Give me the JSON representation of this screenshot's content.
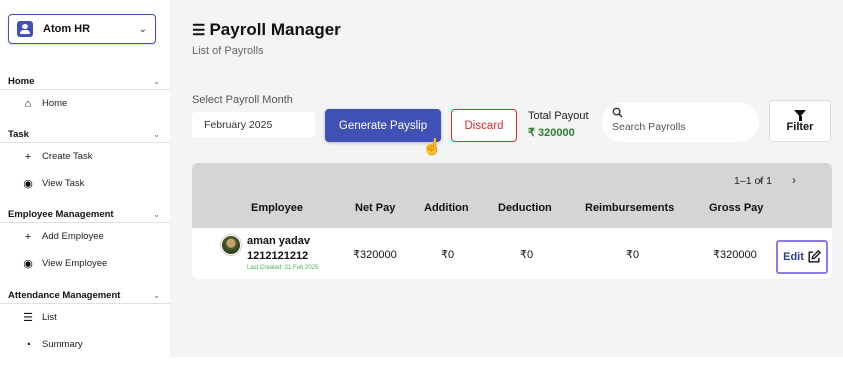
{
  "sidebar": {
    "org": {
      "name": "Atom HR"
    },
    "sections": [
      {
        "title": "Home",
        "items": [
          {
            "label": "Home",
            "icon": "home-icon"
          }
        ]
      },
      {
        "title": "Task",
        "items": [
          {
            "label": "Create Task",
            "icon": "plus-icon"
          },
          {
            "label": "View Task",
            "icon": "eye-icon"
          }
        ]
      },
      {
        "title": "Employee Management",
        "items": [
          {
            "label": "Add Employee",
            "icon": "plus-icon"
          },
          {
            "label": "View Employee",
            "icon": "eye-icon"
          }
        ]
      },
      {
        "title": "Attendance Management",
        "items": [
          {
            "label": "List",
            "icon": "list-icon"
          },
          {
            "label": "Summary",
            "icon": "pie-chart-icon"
          }
        ]
      }
    ]
  },
  "header": {
    "title": "Payroll Manager",
    "subtitle": "List of Payrolls"
  },
  "controls": {
    "month_label": "Select Payroll Month",
    "month_value": "February 2025",
    "generate_label": "Generate Payslip",
    "discard_label": "Discard",
    "payout_label": "Total Payout",
    "payout_value": "₹ 320000",
    "search_placeholder": "Search Payrolls",
    "filter_label": "Filter"
  },
  "table": {
    "pagination": "1–1 of 1",
    "columns": [
      "Employee",
      "Net Pay",
      "Addition",
      "Deduction",
      "Reimbursements",
      "Gross Pay"
    ],
    "rows": [
      {
        "name": "aman yadav",
        "employee_id": "1212121212",
        "created": "Last Created: 21 Feb 2025",
        "net_pay": "₹320000",
        "addition": "₹0",
        "deduction": "₹0",
        "reimbursements": "₹0",
        "gross_pay": "₹320000",
        "action": "Edit"
      }
    ]
  },
  "colors": {
    "primary": "#3f51b5",
    "danger": "#d32f2f",
    "success": "#2e7d32",
    "edit_border": "#8c7ae6"
  }
}
